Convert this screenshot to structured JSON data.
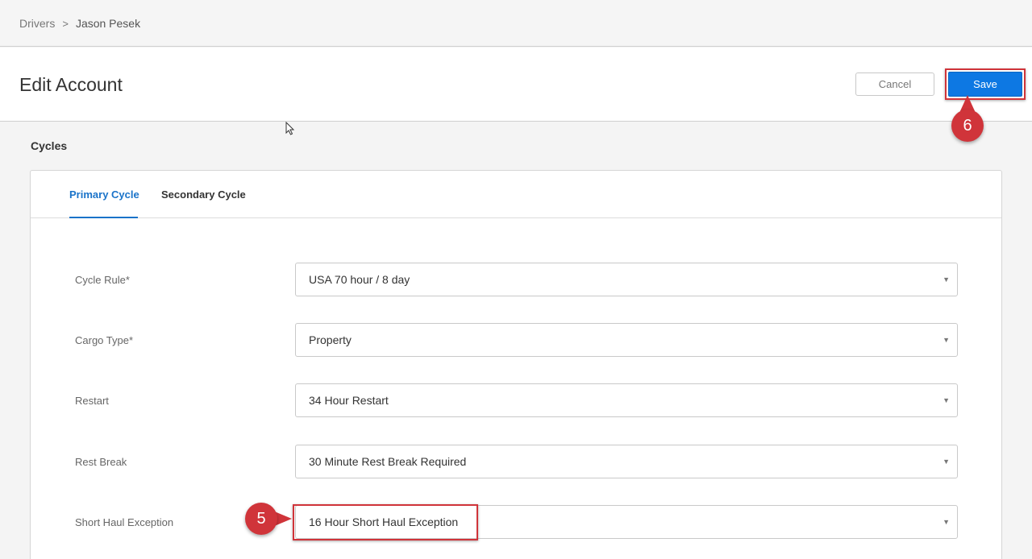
{
  "breadcrumb": {
    "parent": "Drivers",
    "separator": ">",
    "current": "Jason Pesek"
  },
  "header": {
    "title": "Edit Account",
    "cancel_label": "Cancel",
    "save_label": "Save"
  },
  "section": {
    "title": "Cycles"
  },
  "tabs": [
    {
      "label": "Primary Cycle",
      "active": true
    },
    {
      "label": "Secondary Cycle",
      "active": false
    }
  ],
  "fields": [
    {
      "label": "Cycle Rule*",
      "value": "USA 70 hour / 8 day"
    },
    {
      "label": "Cargo Type*",
      "value": "Property"
    },
    {
      "label": "Restart",
      "value": "34 Hour Restart"
    },
    {
      "label": "Rest Break",
      "value": "30 Minute Rest Break Required"
    },
    {
      "label": "Short Haul Exception",
      "value": "16 Hour Short Haul Exception"
    }
  ],
  "annotations": {
    "step_save": "6",
    "step_short_haul": "5"
  },
  "colors": {
    "accent": "#1a73c9",
    "save_button": "#0d78e3",
    "annotation": "#d0343a"
  }
}
